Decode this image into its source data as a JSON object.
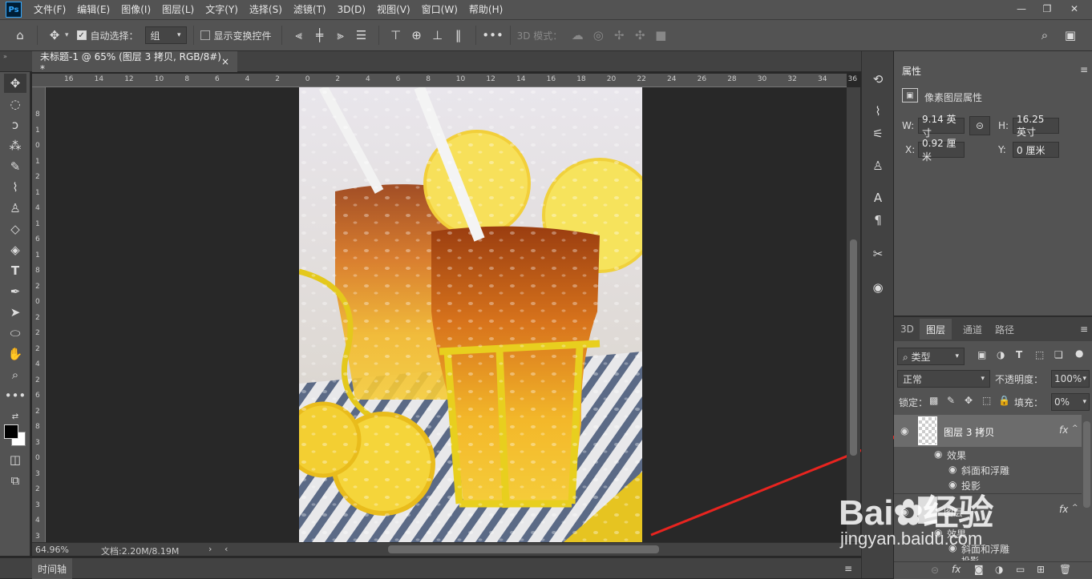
{
  "app": {
    "logo": "Ps"
  },
  "menu": [
    "文件(F)",
    "编辑(E)",
    "图像(I)",
    "图层(L)",
    "文字(Y)",
    "选择(S)",
    "滤镜(T)",
    "3D(D)",
    "视图(V)",
    "窗口(W)",
    "帮助(H)"
  ],
  "options": {
    "auto_select_label": "自动选择：",
    "auto_select_value": "组",
    "show_transform_label": "显示变换控件",
    "mode3d_label": "3D 模式："
  },
  "document": {
    "tab_title": "未标题-1 @ 65% (图层 3 拷贝, RGB/8#) *",
    "close": "×"
  },
  "ruler_top": [
    "16",
    "14",
    "12",
    "10",
    "8",
    "6",
    "4",
    "2",
    "0",
    "2",
    "4",
    "6",
    "8",
    "10",
    "12",
    "14",
    "16",
    "18",
    "20",
    "22",
    "24",
    "26",
    "28",
    "30",
    "32",
    "34",
    "36"
  ],
  "ruler_left": [
    "8",
    "1",
    "0",
    "1",
    "2",
    "1",
    "4",
    "1",
    "6",
    "1",
    "8",
    "2",
    "0",
    "2",
    "2",
    "2",
    "4",
    "2",
    "6",
    "2",
    "8",
    "3",
    "0",
    "3",
    "2",
    "3",
    "4",
    "3"
  ],
  "status": {
    "zoom": "64.96%",
    "doc_info": "文档:2.20M/8.19M"
  },
  "timeline": {
    "label": "时间轴"
  },
  "properties": {
    "tab": "属性",
    "title": "像素图层属性",
    "w_label": "W:",
    "w_value": "9.14 英寸",
    "h_label": "H:",
    "h_value": "16.25 英寸",
    "x_label": "X:",
    "x_value": "0.92 厘米",
    "y_label": "Y:",
    "y_value": "0 厘米"
  },
  "layers_panel": {
    "tabs": [
      "3D",
      "图层",
      "通道",
      "路径"
    ],
    "active_tab": "图层",
    "filter_kind": "类型",
    "blend_mode": "正常",
    "opacity_label": "不透明度：",
    "opacity_value": "100%",
    "lock_label": "锁定：",
    "fill_label": "填充：",
    "fill_value": "0%",
    "layers": [
      {
        "name": "图层 3 拷贝",
        "fx": "fx",
        "effects_label": "效果",
        "effects": [
          "斜面和浮雕",
          "投影"
        ]
      },
      {
        "name": "图层",
        "fx": "fx",
        "effects_label": "效果",
        "effects": [
          "斜面和浮雕",
          "投影"
        ]
      }
    ]
  },
  "watermark": {
    "brand": "Bai",
    "brand2": "经验",
    "url": "jingyan.baidu.com"
  },
  "colors": {
    "ui_dark": "#282828",
    "panel": "#535353",
    "accent_arrow": "#e8241f",
    "ps_blue": "#31a8ff"
  }
}
